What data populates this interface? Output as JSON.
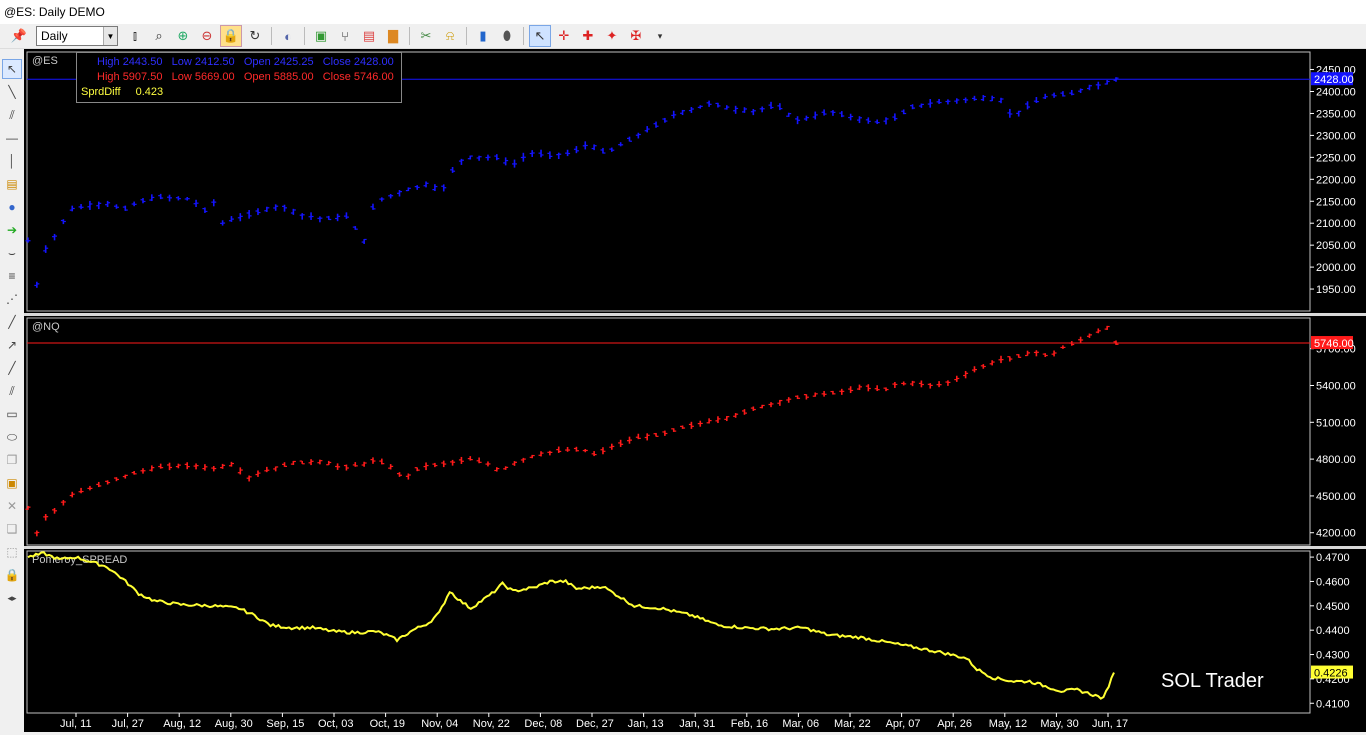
{
  "window": {
    "title": "@ES: Daily DEMO"
  },
  "toolbar": {
    "interval": "Daily",
    "icons": [
      "pin-icon",
      "bars-style-icon",
      "zoom-icon",
      "zoom-in-icon",
      "zoom-out-icon",
      "lock-icon",
      "refresh-icon",
      "globe-icon",
      "chart-settings-icon",
      "tree-icon",
      "indicator-icon",
      "bar-chart-icon",
      "scissors-icon",
      "bell-icon",
      "notebook-icon",
      "eraser-icon",
      "pointer-icon",
      "crosshair-icon",
      "cross-icon",
      "cross-filled-icon",
      "cross-bar-icon",
      "more-icon"
    ]
  },
  "left_tools": [
    "cursor-icon",
    "trendline-icon",
    "parallel-lines-icon",
    "horizontal-line-icon",
    "vertical-line-icon",
    "note-icon",
    "comment-icon",
    "arrow-right-icon",
    "curve-icon",
    "fib-icon",
    "fib-fan-icon",
    "pitchfork-icon",
    "gann-icon",
    "angle-icon",
    "channel-icon",
    "rectangle-icon",
    "ellipse-icon",
    "copy-icon",
    "picture-icon",
    "delete-icon",
    "clone-icon",
    "select-icon",
    "lock-drawing-icon",
    "collapse-icon"
  ],
  "data_window": {
    "es": {
      "high_label": "High",
      "high": "2443.50",
      "low_label": "Low",
      "low": "2412.50",
      "open_label": "Open",
      "open": "2425.25",
      "close_label": "Close",
      "close": "2428.00"
    },
    "nq": {
      "high_label": "High",
      "high": "5907.50",
      "low_label": "Low",
      "low": "5669.00",
      "open_label": "Open",
      "open": "5885.00",
      "close_label": "Close",
      "close": "5746.00"
    },
    "spread": {
      "label": "SprdDiff",
      "value": "0.423"
    }
  },
  "watermark": "SOL Trader",
  "colors": {
    "es": "#1414ff",
    "nq": "#ff1a1a",
    "spread": "#ffff33",
    "background": "#000000",
    "axis_text": "#ffffff"
  },
  "chart_data": [
    {
      "type": "bar",
      "title": "@ES",
      "ylim": [
        1900,
        2490
      ],
      "yticks": [
        1950,
        2000,
        2050,
        2100,
        2150,
        2200,
        2250,
        2300,
        2350,
        2400,
        2450
      ],
      "last_value": "2428.00",
      "grid": false,
      "anchors": [
        [
          0,
          2060
        ],
        [
          3,
          1960
        ],
        [
          6,
          2040
        ],
        [
          10,
          2080
        ],
        [
          14,
          2130
        ],
        [
          20,
          2140
        ],
        [
          28,
          2145
        ],
        [
          32,
          2130
        ],
        [
          38,
          2150
        ],
        [
          45,
          2160
        ],
        [
          55,
          2155
        ],
        [
          60,
          2130
        ],
        [
          65,
          2160
        ],
        [
          66,
          2100
        ],
        [
          70,
          2110
        ],
        [
          80,
          2130
        ],
        [
          86,
          2140
        ],
        [
          92,
          2120
        ],
        [
          100,
          2110
        ],
        [
          108,
          2115
        ],
        [
          112,
          2080
        ],
        [
          114,
          2060
        ],
        [
          116,
          2120
        ],
        [
          118,
          2150
        ],
        [
          122,
          2160
        ],
        [
          128,
          2175
        ],
        [
          136,
          2190
        ],
        [
          140,
          2170
        ],
        [
          144,
          2220
        ],
        [
          148,
          2250
        ],
        [
          160,
          2250
        ],
        [
          164,
          2230
        ],
        [
          170,
          2260
        ],
        [
          178,
          2255
        ],
        [
          184,
          2260
        ],
        [
          190,
          2280
        ],
        [
          196,
          2260
        ],
        [
          204,
          2290
        ],
        [
          212,
          2320
        ],
        [
          220,
          2350
        ],
        [
          226,
          2360
        ],
        [
          232,
          2375
        ],
        [
          238,
          2360
        ],
        [
          246,
          2355
        ],
        [
          254,
          2370
        ],
        [
          260,
          2335
        ],
        [
          265,
          2340
        ],
        [
          272,
          2355
        ],
        [
          280,
          2340
        ],
        [
          288,
          2330
        ],
        [
          294,
          2340
        ],
        [
          300,
          2365
        ],
        [
          308,
          2375
        ],
        [
          316,
          2380
        ],
        [
          324,
          2385
        ],
        [
          330,
          2380
        ],
        [
          334,
          2340
        ],
        [
          338,
          2365
        ],
        [
          346,
          2390
        ],
        [
          354,
          2395
        ],
        [
          360,
          2410
        ],
        [
          366,
          2420
        ],
        [
          369,
          2428
        ]
      ]
    },
    {
      "type": "bar",
      "title": "@NQ",
      "ylim": [
        4100,
        5950
      ],
      "yticks": [
        4200,
        4500,
        4800,
        5100,
        5400,
        5700
      ],
      "last_value": "5746.00",
      "grid": false,
      "anchors": [
        [
          0,
          4400
        ],
        [
          3,
          4200
        ],
        [
          6,
          4330
        ],
        [
          10,
          4400
        ],
        [
          14,
          4500
        ],
        [
          22,
          4570
        ],
        [
          30,
          4640
        ],
        [
          38,
          4700
        ],
        [
          46,
          4740
        ],
        [
          56,
          4750
        ],
        [
          62,
          4720
        ],
        [
          70,
          4760
        ],
        [
          74,
          4640
        ],
        [
          80,
          4700
        ],
        [
          90,
          4770
        ],
        [
          100,
          4780
        ],
        [
          106,
          4730
        ],
        [
          114,
          4760
        ],
        [
          118,
          4800
        ],
        [
          124,
          4720
        ],
        [
          128,
          4630
        ],
        [
          130,
          4700
        ],
        [
          134,
          4740
        ],
        [
          140,
          4760
        ],
        [
          150,
          4800
        ],
        [
          156,
          4760
        ],
        [
          160,
          4700
        ],
        [
          166,
          4780
        ],
        [
          172,
          4830
        ],
        [
          180,
          4870
        ],
        [
          188,
          4880
        ],
        [
          192,
          4840
        ],
        [
          198,
          4900
        ],
        [
          206,
          4970
        ],
        [
          214,
          5000
        ],
        [
          222,
          5060
        ],
        [
          230,
          5100
        ],
        [
          238,
          5140
        ],
        [
          246,
          5210
        ],
        [
          254,
          5260
        ],
        [
          262,
          5310
        ],
        [
          270,
          5330
        ],
        [
          278,
          5360
        ],
        [
          284,
          5390
        ],
        [
          290,
          5360
        ],
        [
          294,
          5410
        ],
        [
          300,
          5420
        ],
        [
          308,
          5400
        ],
        [
          314,
          5440
        ],
        [
          322,
          5540
        ],
        [
          330,
          5610
        ],
        [
          338,
          5650
        ],
        [
          344,
          5680
        ],
        [
          346,
          5620
        ],
        [
          350,
          5700
        ],
        [
          356,
          5760
        ],
        [
          362,
          5830
        ],
        [
          366,
          5870
        ],
        [
          369,
          5746
        ]
      ]
    },
    {
      "type": "line",
      "title": "Pomeroy_SPREAD",
      "ylim": [
        0.406,
        0.4725
      ],
      "yticks": [
        0.41,
        0.42,
        0.43,
        0.44,
        0.45,
        0.46,
        0.47
      ],
      "last_value": "0.4226",
      "grid": false,
      "anchors": [
        [
          0,
          0.47
        ],
        [
          6,
          0.4715
        ],
        [
          12,
          0.469
        ],
        [
          18,
          0.47
        ],
        [
          24,
          0.468
        ],
        [
          30,
          0.466
        ],
        [
          36,
          0.461
        ],
        [
          42,
          0.455
        ],
        [
          48,
          0.452
        ],
        [
          58,
          0.4505
        ],
        [
          70,
          0.45
        ],
        [
          80,
          0.449
        ],
        [
          86,
          0.446
        ],
        [
          92,
          0.442
        ],
        [
          100,
          0.441
        ],
        [
          108,
          0.441
        ],
        [
          116,
          0.4395
        ],
        [
          124,
          0.439
        ],
        [
          132,
          0.4395
        ],
        [
          136,
          0.438
        ],
        [
          140,
          0.436
        ],
        [
          146,
          0.44
        ],
        [
          152,
          0.443
        ],
        [
          156,
          0.447
        ],
        [
          160,
          0.456
        ],
        [
          164,
          0.452
        ],
        [
          168,
          0.449
        ],
        [
          176,
          0.455
        ],
        [
          180,
          0.459
        ],
        [
          184,
          0.456
        ],
        [
          192,
          0.4575
        ],
        [
          198,
          0.46
        ],
        [
          204,
          0.46
        ],
        [
          208,
          0.457
        ],
        [
          214,
          0.4575
        ],
        [
          218,
          0.458
        ],
        [
          224,
          0.454
        ],
        [
          230,
          0.45
        ],
        [
          240,
          0.449
        ],
        [
          252,
          0.446
        ],
        [
          262,
          0.442
        ],
        [
          272,
          0.441
        ],
        [
          282,
          0.4405
        ],
        [
          294,
          0.441
        ],
        [
          304,
          0.438
        ],
        [
          316,
          0.437
        ],
        [
          326,
          0.435
        ],
        [
          336,
          0.433
        ],
        [
          346,
          0.431
        ],
        [
          356,
          0.4285
        ],
        [
          360,
          0.424
        ],
        [
          366,
          0.4205
        ],
        [
          374,
          0.419
        ],
        [
          380,
          0.419
        ],
        [
          386,
          0.417
        ],
        [
          392,
          0.415
        ],
        [
          398,
          0.4155
        ],
        [
          404,
          0.4135
        ],
        [
          408,
          0.412
        ],
        [
          412,
          0.4226
        ]
      ]
    }
  ],
  "x_axis": {
    "labels": [
      "Jul, 11",
      "Jul, 27",
      "Aug, 12",
      "Aug, 30",
      "Sep, 15",
      "Oct, 03",
      "Oct, 19",
      "Nov, 04",
      "Nov, 22",
      "Dec, 08",
      "Dec, 27",
      "Jan, 13",
      "Jan, 31",
      "Feb, 16",
      "Mar, 06",
      "Mar, 22",
      "Apr, 07",
      "Apr, 26",
      "May, 12",
      "May, 30",
      "Jun, 17"
    ]
  }
}
